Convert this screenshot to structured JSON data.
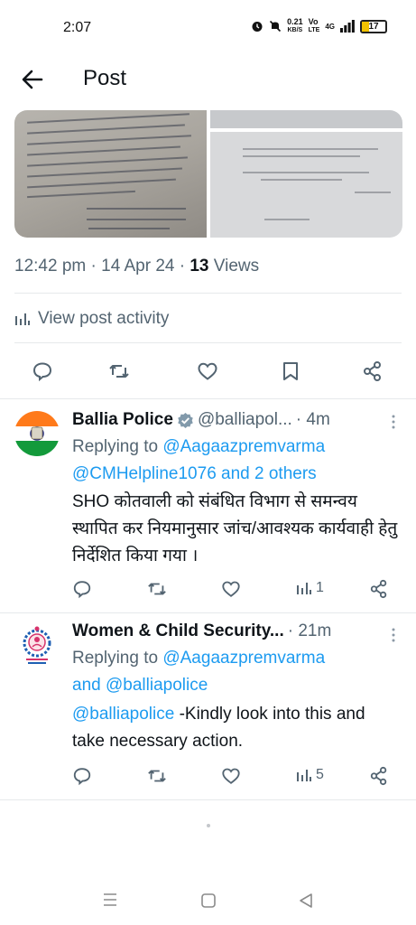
{
  "status": {
    "time": "2:07",
    "speed_value": "0.21",
    "speed_unit": "KB/S",
    "net_top": "Vo",
    "net_bottom": "LTE",
    "signal": "4G",
    "battery": "17"
  },
  "header": {
    "title": "Post",
    "back_icon": "arrow-left-icon"
  },
  "post": {
    "time": "12:42 pm",
    "date": "14 Apr 24",
    "views_count": "13",
    "views_label": "Views",
    "separator": "·",
    "activity_label": "View post activity",
    "actions": [
      "reply-icon",
      "repost-icon",
      "like-icon",
      "bookmark-icon",
      "share-icon"
    ]
  },
  "replies": [
    {
      "name": "Ballia Police",
      "verified": true,
      "handle": "@balliapol...",
      "time": "· 4m",
      "replying_prefix": "Replying to",
      "replying_line1_link": "@Aagaazpremvarma",
      "replying_line2_link": "@CMHelpline1076 and 2 others",
      "text": "SHO कोतवाली को संबंधित विभाग से समन्वय स्थापित कर नियमानुसार जांच/आवश्यक कार्यवाही हेतु निर्देशित किया गया ।",
      "views": "1"
    },
    {
      "name": "Women & Child Security...",
      "time": "· 21m",
      "replying_prefix": "Replying to",
      "replying_line1_link": "@Aagaazpremvarma",
      "replying_line2_link": "and @balliapolice",
      "mention": "@balliapolice",
      "text": " -Kindly look into this and take necessary action.",
      "views": "5"
    }
  ],
  "colors": {
    "link": "#1d9bf0",
    "secondary": "#536471",
    "primary": "#0f1419"
  }
}
